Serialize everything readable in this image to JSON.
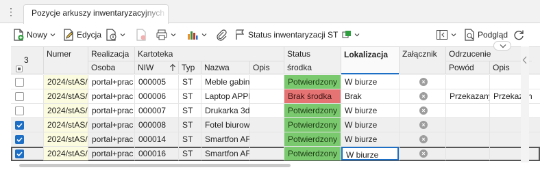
{
  "tab": {
    "title": "Pozycje arkuszy inwentaryzacyjnych"
  },
  "toolbar": {
    "new_label": "Nowy",
    "edit_label": "Edycja",
    "status_label": "Status inwentaryzacji ST",
    "preview_label": "Podgląd"
  },
  "grid": {
    "selected_count": "3",
    "headers": {
      "numer": "Numer",
      "realizacja": "Realizacja",
      "osoba": "Osoba",
      "kartoteka": "Kartoteka",
      "niw": "NIW",
      "typ": "Typ",
      "nazwa": "Nazwa",
      "opis": "Opis",
      "status": "Status",
      "srodka": "środka",
      "lokalizacja": "Lokalizacja",
      "zalacznik": "Załącznik",
      "odrzucenie": "Odrzucenie",
      "powod": "Powód",
      "opis2": "Opis"
    },
    "rows": [
      {
        "checked": false,
        "numer": "2024/stAS/",
        "osoba": "portal+prac",
        "niw": "000005",
        "typ": "ST",
        "nazwa": "Meble gabin",
        "opis": "",
        "status": "Potwierdzony",
        "status_kind": "ok",
        "lokalizacja": "W biurze",
        "powod": "",
        "opis2": ""
      },
      {
        "checked": false,
        "numer": "2024/stAS/",
        "osoba": "portal+prac",
        "niw": "000006",
        "typ": "ST",
        "nazwa": "Laptop APPI",
        "opis": "",
        "status": "Brak środka",
        "status_kind": "bad",
        "lokalizacja": "Brak",
        "powod": "Przekazany",
        "opis2": "Przekazan"
      },
      {
        "checked": false,
        "numer": "2024/stAS/",
        "osoba": "portal+prac",
        "niw": "000007",
        "typ": "ST",
        "nazwa": "Drukarka 3d",
        "opis": "",
        "status": "Potwierdzony",
        "status_kind": "ok",
        "lokalizacja": "W biurze",
        "powod": "",
        "opis2": ""
      },
      {
        "checked": true,
        "numer": "2024/stAS/",
        "osoba": "portal+prac",
        "niw": "000008",
        "typ": "ST",
        "nazwa": "Fotel biurow",
        "opis": "",
        "status": "Potwierdzony",
        "status_kind": "ok",
        "lokalizacja": "W biurze",
        "powod": "",
        "opis2": ""
      },
      {
        "checked": true,
        "numer": "2024/stAS/",
        "osoba": "portal+prac",
        "niw": "000014",
        "typ": "ST",
        "nazwa": "Smartfon AF",
        "opis": "",
        "status": "Potwierdzony",
        "status_kind": "ok",
        "lokalizacja": "W biurze",
        "powod": "",
        "opis2": ""
      },
      {
        "checked": true,
        "numer": "2024/stAS/",
        "osoba": "portal+prac",
        "niw": "000016",
        "typ": "ST",
        "nazwa": "Smartfon AF",
        "opis": "",
        "status": "Potwierdzony",
        "status_kind": "ok",
        "lokalizacja": "W biurze",
        "powod": "",
        "opis2": ""
      }
    ]
  },
  "colors": {
    "accent": "#1d6fc5",
    "ok": "#7bc96f",
    "bad": "#e57373",
    "numer_bg": "#fbfbdf"
  }
}
